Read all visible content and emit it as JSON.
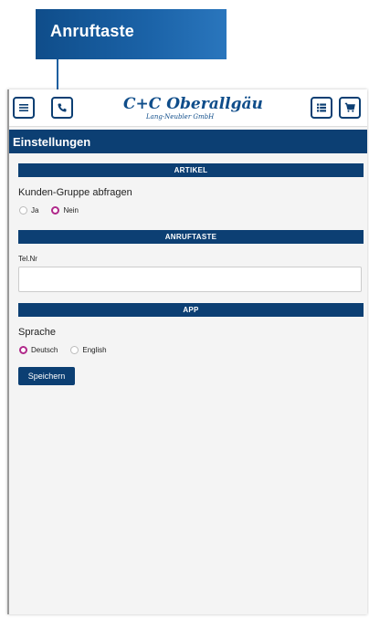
{
  "callout": {
    "label": "Anruftaste"
  },
  "header": {
    "logo_main": "C+C Oberallgäu",
    "logo_sub": "Lang-Neubler GmbH"
  },
  "page": {
    "title": "Einstellungen"
  },
  "sections": {
    "artikel": {
      "heading": "ARTIKEL",
      "question": "Kunden-Gruppe abfragen",
      "options": [
        "Ja",
        "Nein"
      ],
      "selected": "Nein"
    },
    "anruftaste": {
      "heading": "ANRUFTASTE",
      "field_label": "Tel.Nr",
      "field_value": ""
    },
    "app": {
      "heading": "APP",
      "label": "Sprache",
      "options": [
        "Deutsch",
        "English"
      ],
      "selected": "Deutsch"
    }
  },
  "actions": {
    "save_label": "Speichern"
  },
  "colors": {
    "primary": "#0c3f73",
    "radio_accent": "#b0288a"
  },
  "icons": {
    "menu": "menu-icon",
    "phone": "phone-icon",
    "list": "list-icon",
    "cart": "cart-icon"
  }
}
